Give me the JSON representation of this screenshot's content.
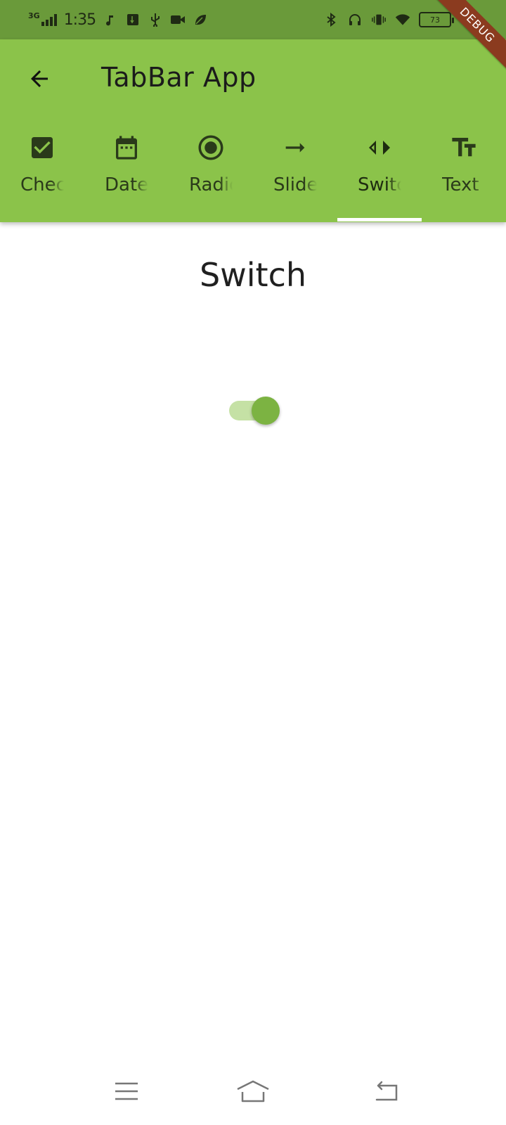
{
  "status_bar": {
    "network": "3G",
    "time": "1:35",
    "battery": "73"
  },
  "debug_ribbon": "DEBUG",
  "app_bar": {
    "title": "TabBar App"
  },
  "tabs": [
    {
      "label": "Checkbox",
      "icon": "checkbox-icon"
    },
    {
      "label": "Date",
      "icon": "calendar-icon"
    },
    {
      "label": "Radio",
      "icon": "radio-icon"
    },
    {
      "label": "Slider",
      "icon": "arrow-right-icon"
    },
    {
      "label": "Switch",
      "icon": "switch-arrows-icon",
      "active": true
    },
    {
      "label": "Text",
      "icon": "text-fields-icon"
    }
  ],
  "content": {
    "title": "Switch",
    "switch_on": true
  },
  "colors": {
    "app_bar": "#8bc34a",
    "status_bar": "#6a9a3a",
    "switch_thumb": "#7cb342",
    "switch_track": "#c5e1a5",
    "debug_ribbon": "#8b3b1f"
  }
}
